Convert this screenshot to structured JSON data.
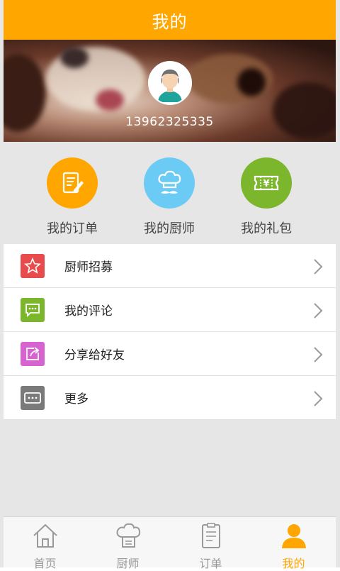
{
  "header": {
    "title": "我的"
  },
  "profile": {
    "phone": "13962325335"
  },
  "quick_actions": [
    {
      "label": "我的订单",
      "icon": "order-document-icon",
      "color": "#ffa600"
    },
    {
      "label": "我的厨师",
      "icon": "chef-hat-icon",
      "color": "#6ccbf5"
    },
    {
      "label": "我的礼包",
      "icon": "gift-ticket-icon",
      "color": "#7cb62c"
    }
  ],
  "menu": [
    {
      "label": "厨师招募",
      "icon": "star-icon",
      "color": "#e84b4b"
    },
    {
      "label": "我的评论",
      "icon": "comment-icon",
      "color": "#7cb62c"
    },
    {
      "label": "分享给好友",
      "icon": "share-icon",
      "color": "#d663d0"
    },
    {
      "label": "更多",
      "icon": "more-icon",
      "color": "#7a7a7a"
    }
  ],
  "tabbar": {
    "items": [
      {
        "label": "首页",
        "icon": "home-icon"
      },
      {
        "label": "厨师",
        "icon": "chef-hat-icon"
      },
      {
        "label": "订单",
        "icon": "order-list-icon"
      },
      {
        "label": "我的",
        "icon": "person-icon"
      }
    ],
    "active_index": 3,
    "active_color": "#ffa600",
    "inactive_color": "#9a9a9a"
  }
}
